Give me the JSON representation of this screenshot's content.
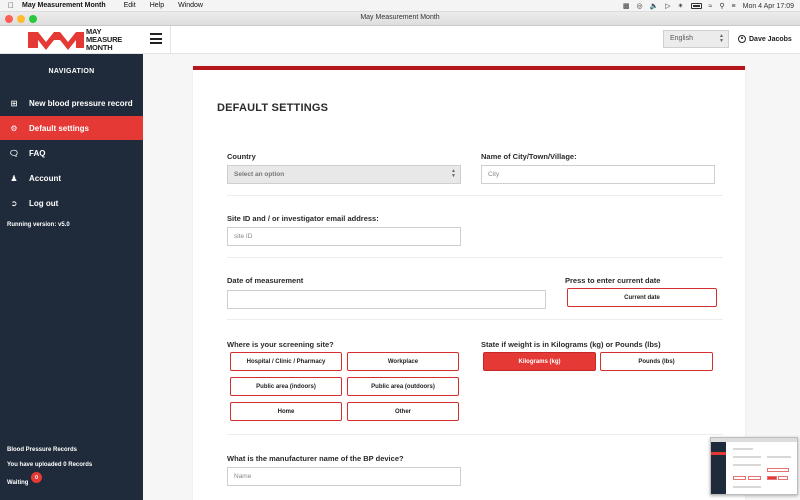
{
  "menubar": {
    "app_name": "May Measurement Month",
    "menus": [
      "Edit",
      "Help",
      "Window"
    ],
    "datetime": "Mon 4 Apr  17:09"
  },
  "window": {
    "title": "May Measurement Month"
  },
  "header": {
    "logo_text_line1": "MAY",
    "logo_text_line2": "MEASURE",
    "logo_text_line3": "MONTH",
    "language": "English",
    "user_name": "Dave Jacobs"
  },
  "sidebar": {
    "title": "NAVIGATION",
    "items": [
      {
        "label": "New blood pressure record",
        "icon": "plus-square-icon"
      },
      {
        "label": "Default settings",
        "icon": "gear-icon"
      },
      {
        "label": "FAQ",
        "icon": "comment-icon"
      },
      {
        "label": "Account",
        "icon": "user-icon"
      },
      {
        "label": "Log out",
        "icon": "sign-out-icon"
      }
    ],
    "version": "Running version: v5.0",
    "bp_records_title": "Blood Pressure Records",
    "uploaded_text": "You have uploaded  0  Records",
    "waiting_label": "Waiting",
    "waiting_count": "0"
  },
  "page": {
    "title": "DEFAULT SETTINGS",
    "country_label": "Country",
    "country_value": "Select an option",
    "city_label": "Name of City/Town/Village:",
    "city_placeholder": "City",
    "site_id_label": "Site ID and / or investigator email address:",
    "site_id_placeholder": "site ID",
    "date_label": "Date of measurement",
    "date_value": "",
    "current_date_label": "Press to enter current date",
    "current_date_button": "Current date",
    "screening_site_label": "Where is your screening site?",
    "screening_sites": [
      "Hospital / Clinic / Pharmacy",
      "Workplace",
      "Public area (indoors)",
      "Public area (outdoors)",
      "Home",
      "Other"
    ],
    "weight_label": "State if weight is in Kilograms (kg) or Pounds (lbs)",
    "weight_options": [
      "Kilograms (kg)",
      "Pounds (lbs)"
    ],
    "weight_selected": "Kilograms (kg)",
    "manufacturer_label": "What is the manufacturer name of the BP device?",
    "manufacturer_placeholder": "Name"
  },
  "colors": {
    "accent_red": "#e53935",
    "dark_red": "#b3171b",
    "sidebar_bg": "#1f2a3a"
  }
}
